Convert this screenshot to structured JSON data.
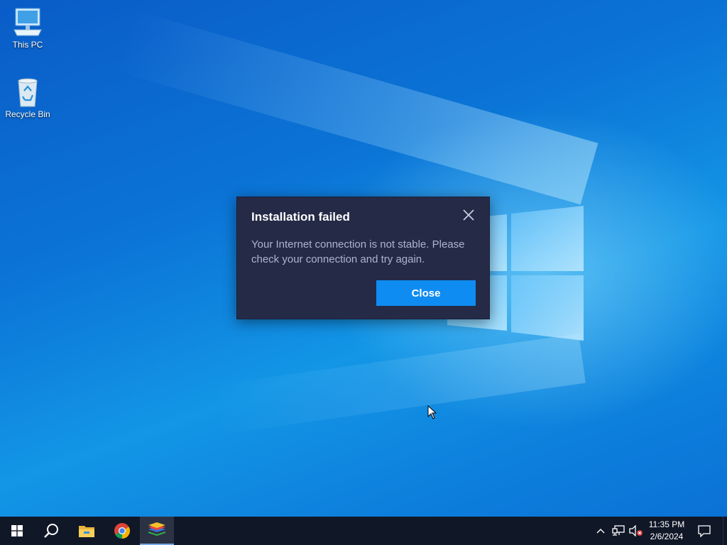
{
  "desktop": {
    "icons": [
      {
        "label": "This PC",
        "icon": "computer-icon"
      },
      {
        "label": "Recycle Bin",
        "icon": "recycle-bin-icon"
      }
    ]
  },
  "dialog": {
    "title": "Installation failed",
    "message": "Your Internet connection is not stable. Please check your connection and try again.",
    "close_button_label": "Close",
    "close_icon": "close-icon",
    "colors": {
      "background": "#252a47",
      "button": "#0f8cf2",
      "message_text": "#aeb4cc"
    }
  },
  "taskbar": {
    "pinned": [
      {
        "name": "start",
        "icon": "windows-start-icon"
      },
      {
        "name": "search",
        "icon": "search-icon"
      },
      {
        "name": "file-explorer",
        "icon": "folder-icon"
      },
      {
        "name": "chrome",
        "icon": "chrome-icon"
      },
      {
        "name": "bluestacks",
        "icon": "bluestacks-icon",
        "active": true
      }
    ],
    "tray": {
      "icons": [
        "chevron-up-icon",
        "network-icon",
        "volume-muted-icon"
      ],
      "time": "11:35 PM",
      "date": "2/6/2024",
      "notification_icon": "notification-icon"
    }
  }
}
